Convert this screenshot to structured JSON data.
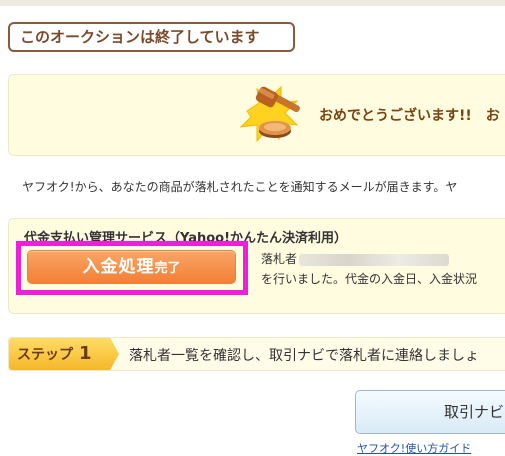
{
  "auction": {
    "closed_label": "このオークションは終了しています"
  },
  "congrats": {
    "message": "おめでとうございます!!　お"
  },
  "notice": {
    "text": "ヤフオク!から、あなたの商品が落札されたことを通知するメールが届きます。ヤ"
  },
  "payment": {
    "title": "代金支払い管理サービス（Yahoo!かんたん決済利用）",
    "button_main": "入金処理",
    "button_sub": "完了",
    "desc_line1": "落札者",
    "desc_line2": "を行いました。代金の入金日、入金状況"
  },
  "step": {
    "label": "ステップ",
    "number": "1",
    "text": "落札者一覧を確認し、取引ナビで落札者に連絡しましょ"
  },
  "nav": {
    "button_label": "取引ナビ"
  },
  "help": {
    "link_text": "ヤフオク!使い方ガイド"
  },
  "colors": {
    "highlight": "#ef1fd9",
    "button_orange": "#f47f36",
    "panel_yellow": "#fffce0",
    "badge_brown": "#7a4a2a"
  }
}
